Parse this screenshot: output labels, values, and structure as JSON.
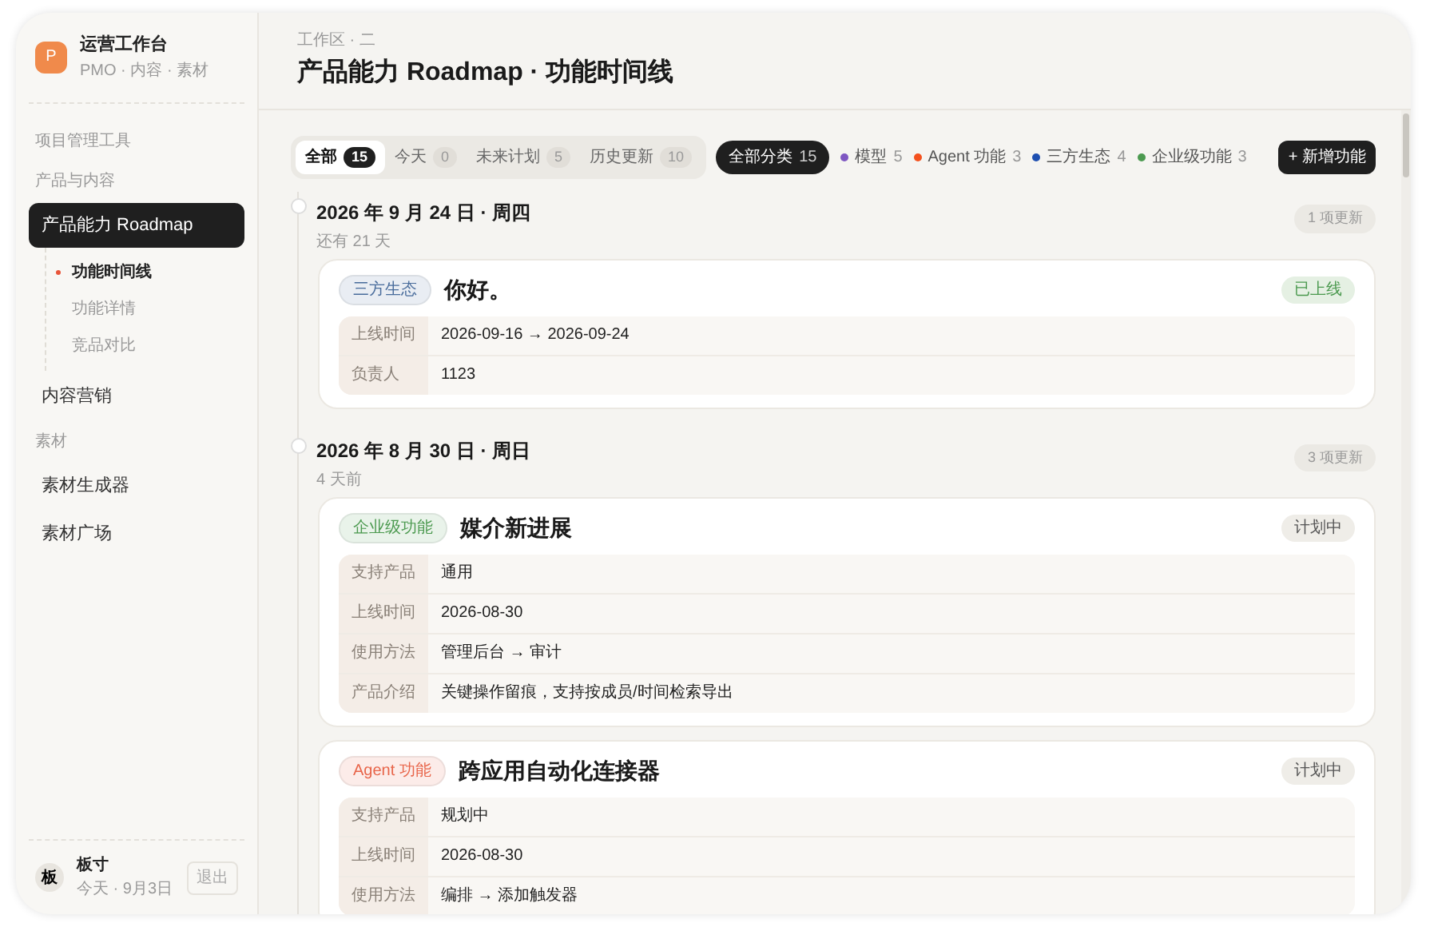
{
  "app": {
    "logo": "P",
    "name": "运营工作台",
    "subtitle": "PMO · 内容 · 素材"
  },
  "sidebar": {
    "sections": [
      {
        "label": "项目管理工具"
      },
      {
        "label": "产品与内容",
        "items": [
          {
            "label": "产品能力 Roadmap",
            "selected": true,
            "children": [
              {
                "label": "功能时间线",
                "selected": true
              },
              {
                "label": "功能详情",
                "selected": false
              },
              {
                "label": "竞品对比",
                "selected": false
              }
            ]
          },
          {
            "label": "内容营销",
            "selected": false
          }
        ]
      },
      {
        "label": "素材",
        "items": [
          {
            "label": "素材生成器",
            "selected": false
          },
          {
            "label": "素材广场",
            "selected": false
          }
        ]
      }
    ]
  },
  "user": {
    "avatar": "板",
    "name": "板寸",
    "date": "今天 · 9月3日",
    "logout": "退出"
  },
  "header": {
    "breadcrumb": "工作区 · 二",
    "title": "产品能力 Roadmap · 功能时间线"
  },
  "tabs": [
    {
      "label": "全部",
      "count": "15",
      "selected": true
    },
    {
      "label": "今天",
      "count": "0",
      "selected": false
    },
    {
      "label": "未来计划",
      "count": "5",
      "selected": false
    },
    {
      "label": "历史更新",
      "count": "10",
      "selected": false
    }
  ],
  "categories": [
    {
      "label": "全部分类",
      "count": "15",
      "selected": true
    },
    {
      "label": "模型",
      "count": "5",
      "color": "#7e57c2",
      "selected": false
    },
    {
      "label": "Agent 功能",
      "count": "3",
      "color": "#f4511e",
      "selected": false
    },
    {
      "label": "三方生态",
      "count": "4",
      "color": "#1e4fb0",
      "selected": false
    },
    {
      "label": "企业级功能",
      "count": "3",
      "color": "#4c9a50",
      "selected": false
    }
  ],
  "add_button": "+ 新增功能",
  "groups": [
    {
      "date": "2026 年 9 月 24 日 · 周四",
      "relative": "还有 21 天",
      "count_label": "1 项更新",
      "features": [
        {
          "tag": {
            "label": "三方生态",
            "color": "#4a6d9c"
          },
          "title": "你好。",
          "status": {
            "label": "已上线",
            "kind": "live"
          },
          "fields": [
            {
              "label": "上线时间",
              "value": "2026-09-16 → 2026-09-24"
            },
            {
              "label": "负责人",
              "value": "1123"
            }
          ]
        }
      ]
    },
    {
      "date": "2026 年 8 月 30 日 · 周日",
      "relative": "4 天前",
      "count_label": "3 项更新",
      "features": [
        {
          "tag": {
            "label": "企业级功能",
            "color": "#4c9a50"
          },
          "title": "媒介新进展",
          "status": {
            "label": "计划中",
            "kind": "planned"
          },
          "fields": [
            {
              "label": "支持产品",
              "value": "通用"
            },
            {
              "label": "上线时间",
              "value": "2026-08-30"
            },
            {
              "label": "使用方法",
              "value": "管理后台 → 审计"
            },
            {
              "label": "产品介绍",
              "value": "关键操作留痕，支持按成员/时间检索导出"
            }
          ]
        },
        {
          "tag": {
            "label": "Agent 功能",
            "color": "#e8654a"
          },
          "title": "跨应用自动化连接器",
          "status": {
            "label": "计划中",
            "kind": "planned"
          },
          "fields": [
            {
              "label": "支持产品",
              "value": "规划中"
            },
            {
              "label": "上线时间",
              "value": "2026-08-30"
            },
            {
              "label": "使用方法",
              "value": "编排 → 添加触发器"
            }
          ]
        }
      ]
    }
  ]
}
